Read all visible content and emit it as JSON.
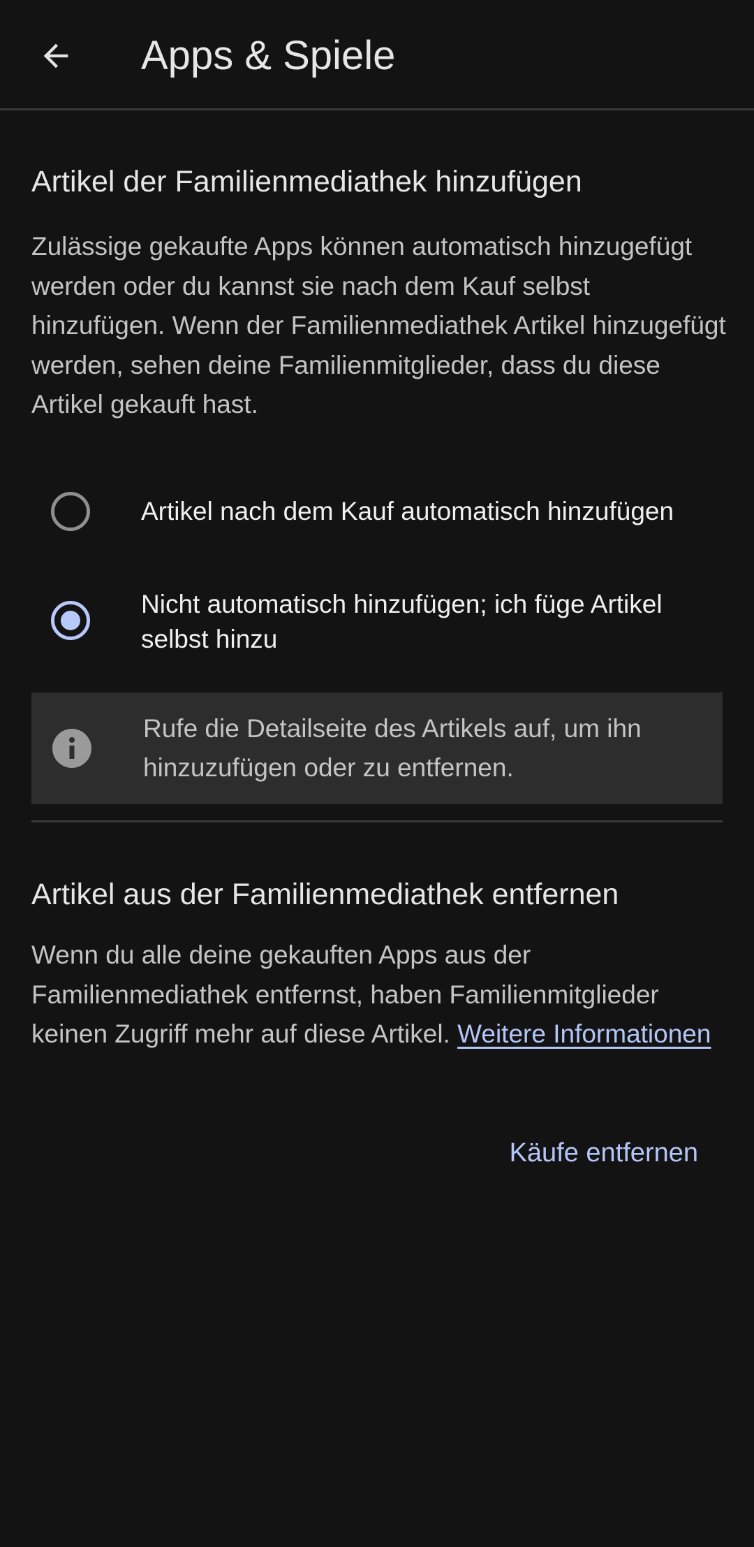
{
  "appbar": {
    "back_icon": "arrow-back-icon",
    "title": "Apps & Spiele"
  },
  "add_section": {
    "title": "Artikel der Familienmediathek hinzufügen",
    "description": "Zulässige gekaufte Apps können automatisch hinzugefügt werden oder du kannst sie nach dem Kauf selbst hinzufügen. Wenn der Familienmediathek Artikel hinzugefügt werden, sehen deine Familienmitglieder, dass du diese Artikel gekauft hast.",
    "options": [
      {
        "label": "Artikel nach dem Kauf automatisch hinzufügen",
        "selected": false
      },
      {
        "label": "Nicht automatisch hinzufügen; ich füge Artikel selbst hinzu",
        "selected": true
      }
    ],
    "info": {
      "icon": "info-icon",
      "text": "Rufe die Detailseite des Artikels auf, um ihn hinzuzufügen oder zu entfernen."
    }
  },
  "remove_section": {
    "title": "Artikel aus der Familienmediathek entfernen",
    "description": "Wenn du alle deine gekauften Apps aus der Familienmediathek entfernst, haben Familienmitglieder keinen Zugriff mehr auf diese Artikel.",
    "link_label": "Weitere Informationen",
    "button_label": "Käufe entfernen"
  },
  "colors": {
    "background": "#131313",
    "accent": "#b4c6f7",
    "info_box": "#2d2d2d"
  }
}
